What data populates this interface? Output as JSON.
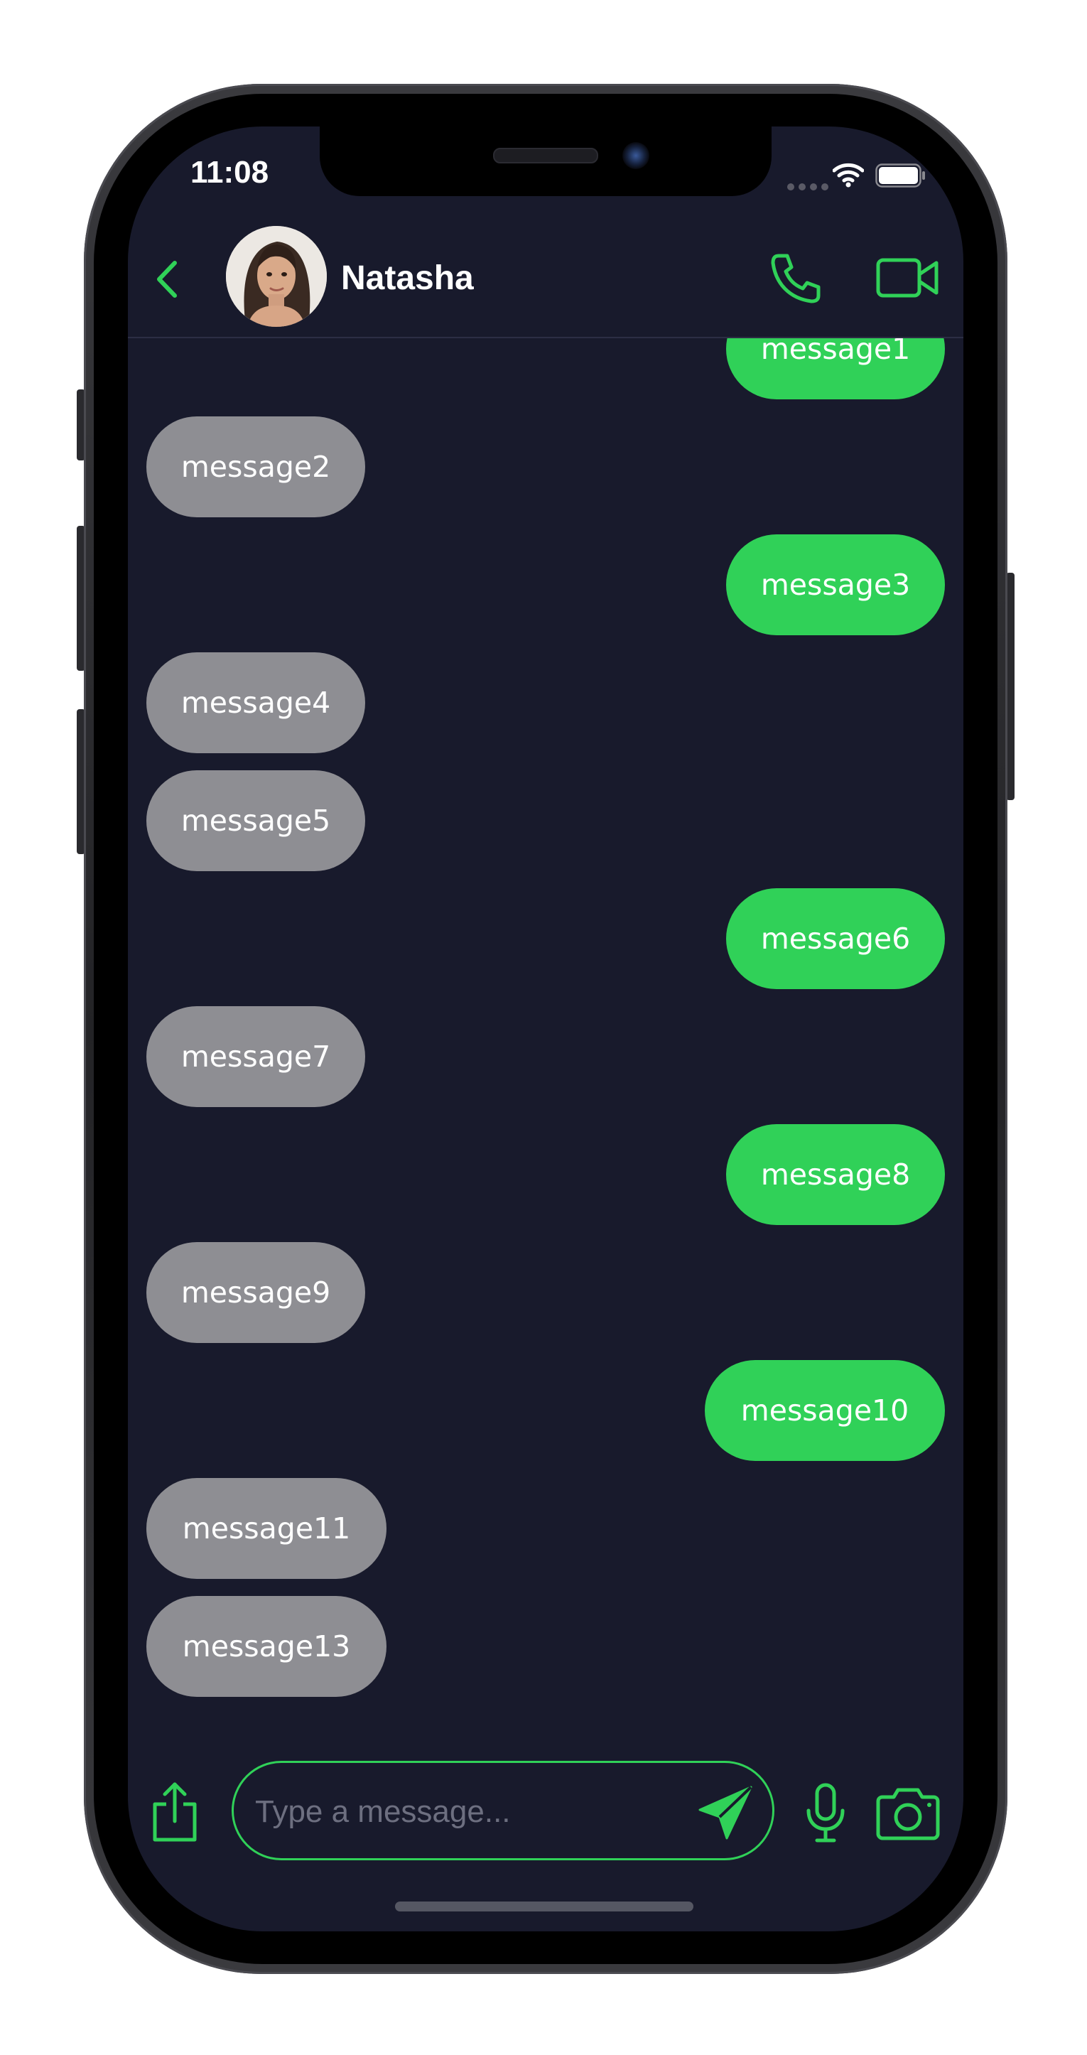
{
  "status_bar": {
    "time": "11:08"
  },
  "header": {
    "contact_name": "Natasha"
  },
  "messages": [
    {
      "text": "message1",
      "direction": "sent"
    },
    {
      "text": "message2",
      "direction": "received"
    },
    {
      "text": "message3",
      "direction": "sent"
    },
    {
      "text": "message4",
      "direction": "received"
    },
    {
      "text": "message5",
      "direction": "received"
    },
    {
      "text": "message6",
      "direction": "sent"
    },
    {
      "text": "message7",
      "direction": "received"
    },
    {
      "text": "message8",
      "direction": "sent"
    },
    {
      "text": "message9",
      "direction": "received"
    },
    {
      "text": "message10",
      "direction": "sent"
    },
    {
      "text": "message11",
      "direction": "received"
    },
    {
      "text": "message13",
      "direction": "received"
    }
  ],
  "composer": {
    "placeholder": "Type a message..."
  },
  "icons": {
    "back": "chevron-left-icon",
    "call": "phone-icon",
    "video": "video-camera-icon",
    "share": "share-icon",
    "send": "send-icon",
    "mic": "microphone-icon",
    "camera": "camera-icon"
  },
  "colors": {
    "accent": "#30d158",
    "sent_bubble": "#30d158",
    "received_bubble": "#8e8e93",
    "background": "#181a2c"
  }
}
